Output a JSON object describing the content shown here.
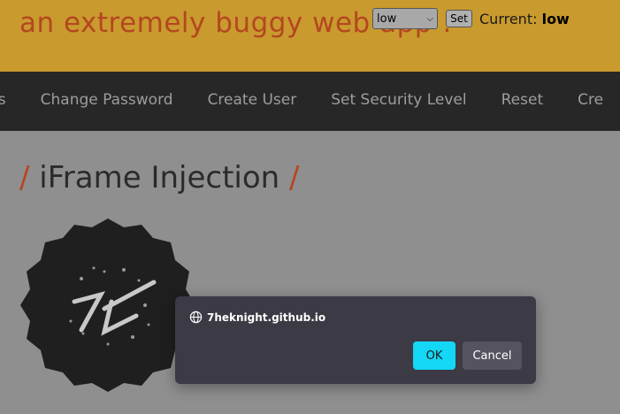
{
  "header": {
    "tagline": "an extremely buggy web app !",
    "security": {
      "selected": "low",
      "set_label": "Set",
      "current_label": "Current:",
      "current_value": "low"
    }
  },
  "nav": {
    "items": [
      "gs",
      "Change Password",
      "Create User",
      "Set Security Level",
      "Reset",
      "Cre"
    ]
  },
  "page": {
    "slash": "/",
    "title": "iFrame Injection"
  },
  "dialog": {
    "origin": "7heknight.github.io",
    "ok_label": "OK",
    "cancel_label": "Cancel",
    "ok_color": "#13d7f5"
  },
  "icons": {
    "globe": "globe-icon",
    "logo": "logo-badge"
  }
}
